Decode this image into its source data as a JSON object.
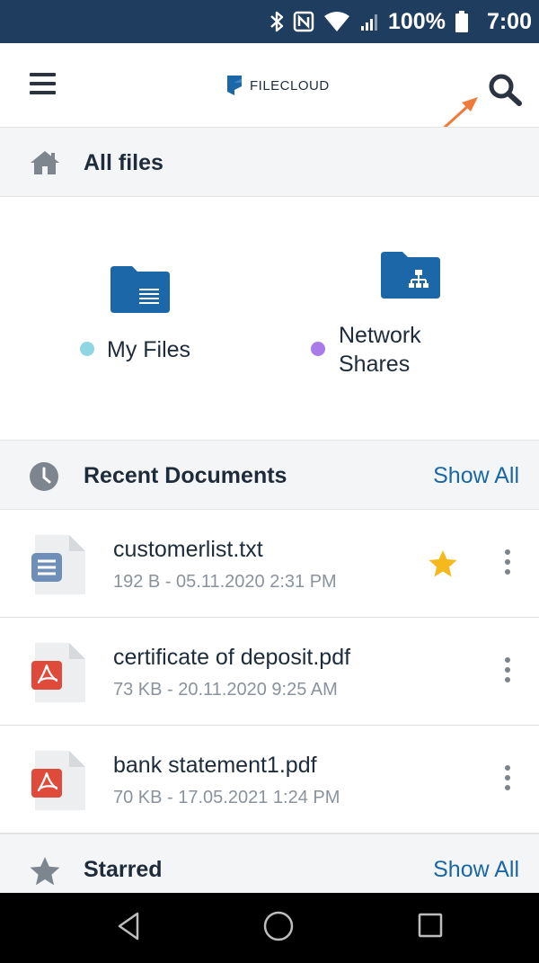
{
  "status_bar": {
    "battery_percent": "100%",
    "time": "7:00",
    "icons": [
      "bluetooth-icon",
      "nfc-icon",
      "wifi-icon",
      "signal-icon",
      "battery-icon"
    ]
  },
  "app_bar": {
    "logo_text": "FILECLOUD",
    "menu_icon": "hamburger-menu-icon",
    "search_icon": "search-icon",
    "annotation_arrow_color": "#f07a3a"
  },
  "all_files": {
    "title": "All files",
    "icon": "home-icon",
    "shortcuts": [
      {
        "label": "My Files",
        "dot_color": "#8fd6e3",
        "icon": "folder-document-icon"
      },
      {
        "label_line1": "Network",
        "label_line2": "Shares",
        "dot_color": "#a87be8",
        "icon": "folder-network-icon"
      }
    ]
  },
  "recent": {
    "title": "Recent Documents",
    "icon": "clock-icon",
    "show_all": "Show All",
    "files": [
      {
        "name": "customerlist.txt",
        "meta": "192 B - 05.11.2020 2:31 PM",
        "type": "txt",
        "starred": true
      },
      {
        "name": "certificate of deposit.pdf",
        "meta": "73 KB - 20.11.2020 9:25 AM",
        "type": "pdf",
        "starred": false
      },
      {
        "name": "bank statement1.pdf",
        "meta": "70 KB - 17.05.2021 1:24 PM",
        "type": "pdf",
        "starred": false
      }
    ]
  },
  "starred": {
    "title": "Starred",
    "icon": "star-icon",
    "show_all": "Show All"
  },
  "colors": {
    "status_bar": "#1e3d5f",
    "folder_blue": "#1c67a8",
    "link_blue": "#1a67a6",
    "pdf_red": "#e04a3a",
    "txt_blue": "#6f8fb8",
    "star_gold": "#f6b91c"
  }
}
